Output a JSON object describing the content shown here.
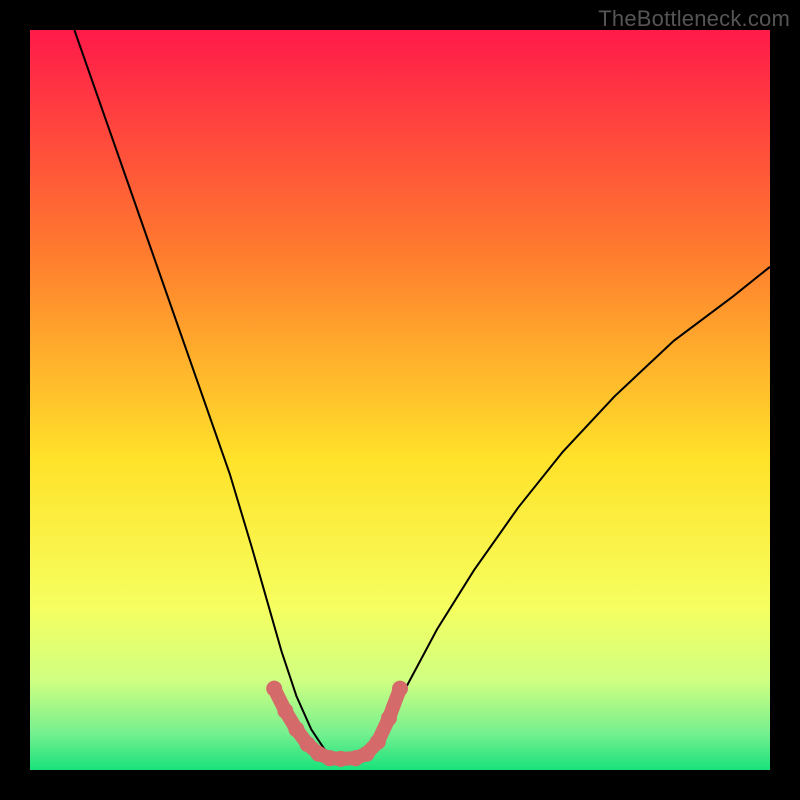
{
  "watermark": "TheBottleneck.com",
  "colors": {
    "top": "#ff1a4a",
    "mid_upper": "#ff7b2e",
    "mid": "#ffe22a",
    "mid_lower": "#f6ff60",
    "low1": "#cfff82",
    "low2": "#76f08f",
    "bottom": "#18e27c",
    "curve": "#000000",
    "highlight": "#d46a6a"
  },
  "chart_data": {
    "type": "line",
    "title": "",
    "xlabel": "",
    "ylabel": "",
    "xlim": [
      0,
      1
    ],
    "ylim": [
      0,
      1
    ],
    "series": [
      {
        "name": "bottleneck-curve",
        "x": [
          0.06,
          0.095,
          0.13,
          0.165,
          0.2,
          0.235,
          0.27,
          0.3,
          0.32,
          0.34,
          0.36,
          0.38,
          0.4,
          0.42,
          0.44,
          0.46,
          0.48,
          0.51,
          0.55,
          0.6,
          0.66,
          0.72,
          0.79,
          0.87,
          0.95,
          1.0
        ],
        "y": [
          1.0,
          0.9,
          0.8,
          0.7,
          0.6,
          0.5,
          0.4,
          0.3,
          0.23,
          0.16,
          0.1,
          0.055,
          0.025,
          0.015,
          0.015,
          0.025,
          0.06,
          0.115,
          0.19,
          0.27,
          0.355,
          0.43,
          0.505,
          0.58,
          0.64,
          0.68
        ]
      },
      {
        "name": "valley-highlight",
        "x": [
          0.33,
          0.345,
          0.36,
          0.375,
          0.39,
          0.405,
          0.42,
          0.44,
          0.455,
          0.47,
          0.485,
          0.5
        ],
        "y": [
          0.11,
          0.08,
          0.055,
          0.035,
          0.022,
          0.016,
          0.015,
          0.016,
          0.022,
          0.038,
          0.07,
          0.11
        ]
      }
    ],
    "gradient_stops": [
      {
        "pos": 0.0,
        "color": "#ff1a4a"
      },
      {
        "pos": 0.3,
        "color": "#ff7b2e"
      },
      {
        "pos": 0.58,
        "color": "#ffe22a"
      },
      {
        "pos": 0.78,
        "color": "#f6ff60"
      },
      {
        "pos": 0.88,
        "color": "#cfff82"
      },
      {
        "pos": 0.95,
        "color": "#76f08f"
      },
      {
        "pos": 1.0,
        "color": "#18e27c"
      }
    ]
  }
}
